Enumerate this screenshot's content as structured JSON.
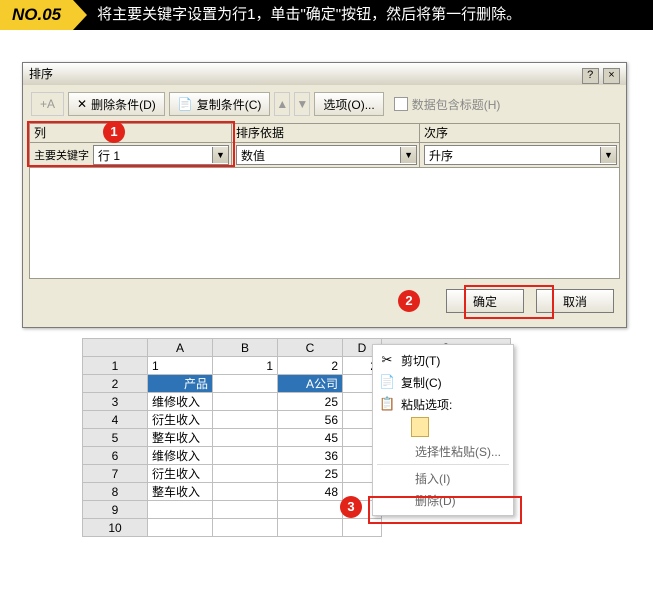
{
  "banner": {
    "num": "NO.05",
    "text": "将主要关键字设置为行1，单击\"确定\"按钮，然后将第一行删除。"
  },
  "dialog": {
    "title": "排序",
    "help": "?",
    "close": "×",
    "toolbar": {
      "add": "+",
      "delete": "删除条件(D)",
      "copy": "复制条件(C)",
      "options": "选项(O)...",
      "headerchk": "数据包含标题(H)"
    },
    "headers": {
      "col": "列",
      "by": "排序依据",
      "order": "次序"
    },
    "row": {
      "label": "主要关键字",
      "field": "行 1",
      "by": "数值",
      "order": "升序"
    },
    "ok": "确定",
    "cancel": "取消"
  },
  "callouts": {
    "c1": "1",
    "c2": "2",
    "c3": "3"
  },
  "sheet": {
    "cols": [
      "A",
      "B",
      "C",
      "D"
    ],
    "rows": [
      {
        "n": "1",
        "A": "1",
        "B": "1",
        "C": "2",
        "D": "2"
      },
      {
        "n": "2",
        "A": "产品",
        "B": "",
        "C": "A公司",
        "D": ""
      },
      {
        "n": "3",
        "A": "维修收入",
        "B": "",
        "C": "25",
        "D": ""
      },
      {
        "n": "4",
        "A": "衍生收入",
        "B": "",
        "C": "56",
        "D": ""
      },
      {
        "n": "5",
        "A": "整车收入",
        "B": "",
        "C": "45",
        "D": ""
      },
      {
        "n": "6",
        "A": "维修收入",
        "B": "",
        "C": "36",
        "D": ""
      },
      {
        "n": "7",
        "A": "衍生收入",
        "B": "",
        "C": "25",
        "D": ""
      },
      {
        "n": "8",
        "A": "整车收入",
        "B": "",
        "C": "48",
        "D": ""
      },
      {
        "n": "9",
        "A": "",
        "B": "",
        "C": "",
        "D": ""
      },
      {
        "n": "10",
        "A": "",
        "B": "",
        "C": "",
        "D": ""
      }
    ],
    "extraHead": "3"
  },
  "ctx": {
    "cut": "剪切(T)",
    "copy": "复制(C)",
    "pasteopt": "粘贴选项:",
    "special": "选择性粘贴(S)...",
    "insert": "插入(I)",
    "delete": "删除(D)"
  }
}
